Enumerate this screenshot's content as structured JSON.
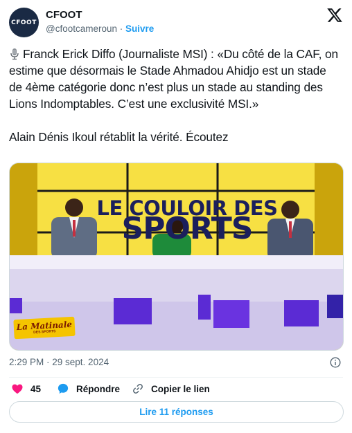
{
  "author": {
    "name": "CFOOT",
    "handle": "@cfootcameroun",
    "separator": "·",
    "follow_label": "Suivre",
    "avatar_text": "CFOOT"
  },
  "icons": {
    "brand": "x-logo-icon",
    "microphone": "microphone-icon",
    "info": "info-icon",
    "like": "heart-icon",
    "reply": "speech-bubble-icon",
    "copy": "link-icon"
  },
  "tweet": {
    "paragraph1": "Franck Erick Diffo (Journaliste MSI) : «Du côté de la CAF, on estime que désormais le Stade Ahmadou Ahidjo est un stade de 4ème catégorie donc n’est plus un stade au standing des Lions Indomptables. C’est une exclusivité MSI.»",
    "paragraph2": "Alain Dénis Ikoul rétablit la vérité. Écoutez"
  },
  "media": {
    "show_title_line1": "LE COULOIR DES",
    "show_title_line2": "SPORTS",
    "badge_line1": "La Matinale",
    "badge_line2": "DES SPORTS"
  },
  "meta": {
    "timestamp": "2:29 PM · 29 sept. 2024"
  },
  "actions": {
    "like_count": "45",
    "reply_label": "Répondre",
    "copy_label": "Copier le lien"
  },
  "replies_button": "Lire 11 réponses",
  "colors": {
    "accent": "#1d9bf0",
    "like": "#f91880",
    "text": "#0f1419",
    "secondary": "#536471"
  }
}
